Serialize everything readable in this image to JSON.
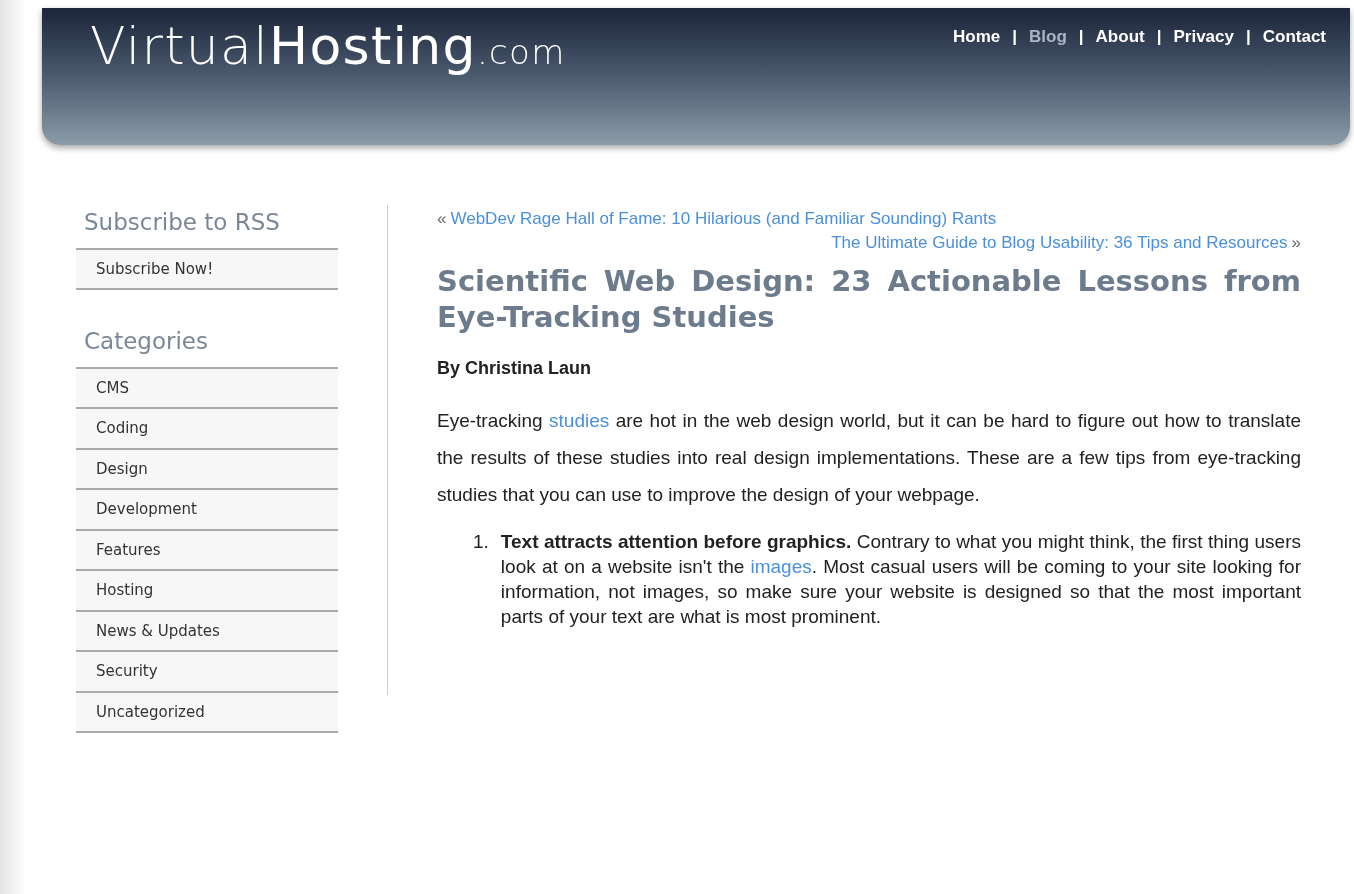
{
  "header": {
    "logo": {
      "light": "Virtual",
      "bold": "Hosting",
      "suffix": ".com"
    },
    "nav": [
      {
        "label": "Home",
        "selected": false
      },
      {
        "label": "Blog",
        "selected": true
      },
      {
        "label": "About",
        "selected": false
      },
      {
        "label": "Privacy",
        "selected": false
      },
      {
        "label": "Contact",
        "selected": false
      }
    ],
    "separator": "|"
  },
  "sidebar": {
    "sections": [
      {
        "title": "Subscribe to RSS",
        "items": [
          "Subscribe Now!"
        ]
      },
      {
        "title": "Categories",
        "items": [
          "CMS",
          "Coding",
          "Design",
          "Development",
          "Features",
          "Hosting",
          "News & Updates",
          "Security",
          "Uncategorized"
        ]
      }
    ]
  },
  "post": {
    "prev_link": {
      "mark": "«",
      "label": "WebDev Rage Hall of Fame: 10 Hilarious (and Familiar Sounding) Rants"
    },
    "next_link": {
      "mark": "»",
      "label": "The Ultimate Guide to Blog Usability: 36 Tips and Resources"
    },
    "title": "Scientific Web Design: 23 Actionable Lessons from Eye-Tracking Studies",
    "author": "By Christina Laun",
    "intro": [
      {
        "text": "Eye-tracking "
      },
      {
        "text": "studies",
        "link": true
      },
      {
        "text": " are hot in the web design world, but it can be hard to figure out how to translate the results of these studies into real design implementations. These are a few tips from eye-tracking studies that you can use to improve the design of your webpage."
      }
    ],
    "list": [
      {
        "number": "1.",
        "lead": "Text attracts attention before graphics.",
        "body": [
          {
            "text": " Contrary to what you might think, the first thing users look at on a website isn't the "
          },
          {
            "text": "images",
            "link": true
          },
          {
            "text": ". Most casual users will be coming to your site looking for information, not images, so make sure your website is designed so that the most important parts of your text are what is most prominent."
          }
        ]
      }
    ]
  }
}
